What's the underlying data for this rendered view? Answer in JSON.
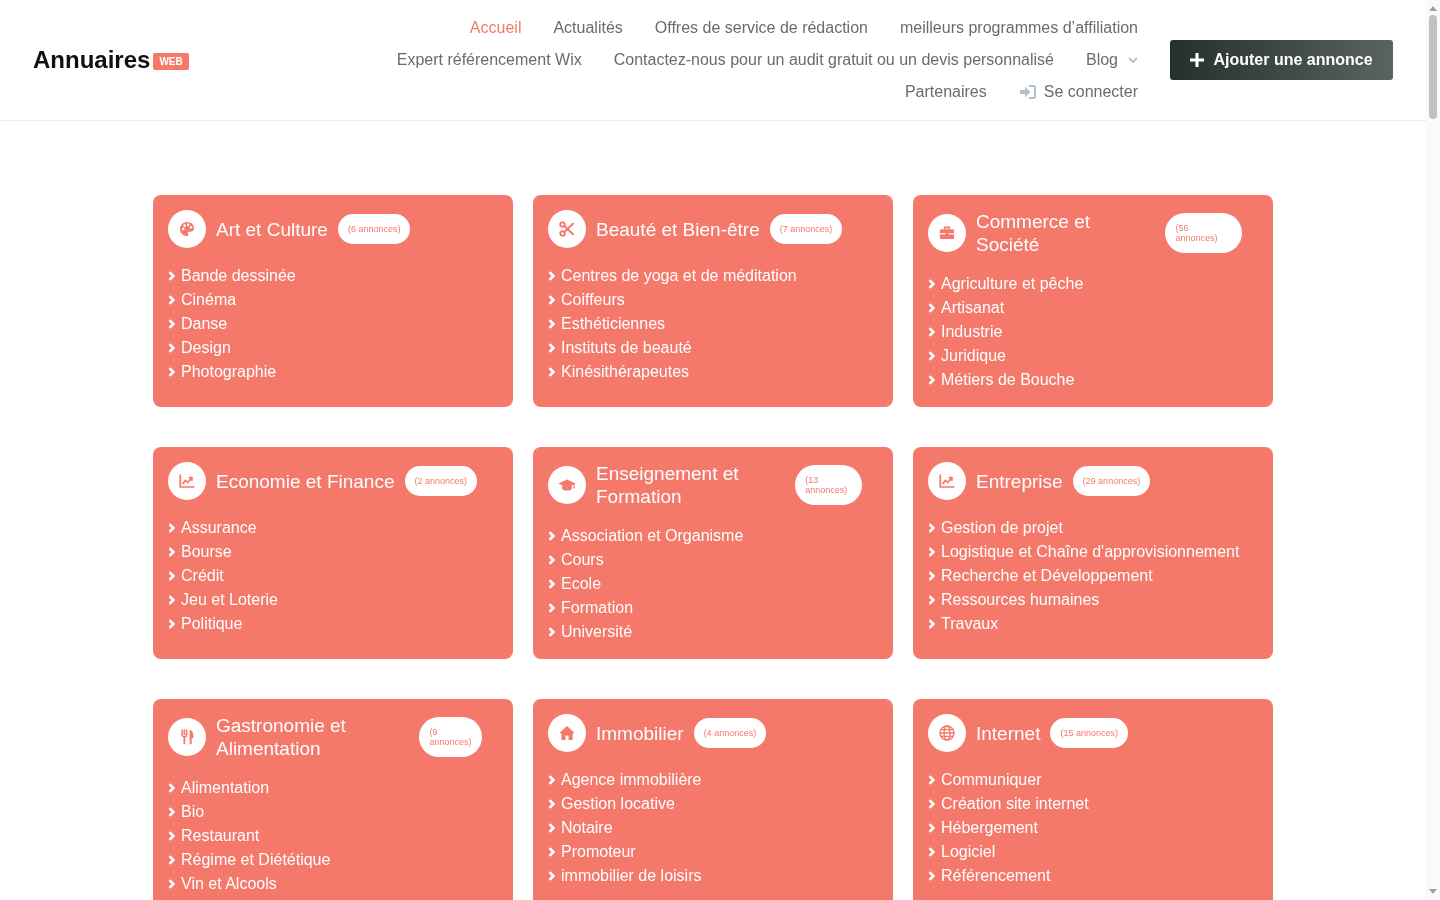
{
  "header": {
    "logo": {
      "name": "Annuaires",
      "badge": "WEB"
    },
    "nav": [
      {
        "label": "Accueil",
        "kind": "link",
        "selected": true
      },
      {
        "label": "Actualités",
        "kind": "link",
        "selected": false
      },
      {
        "label": "Offres de service de rédaction",
        "kind": "link",
        "selected": false
      },
      {
        "label": "meilleurs programmes d’affiliation",
        "kind": "link",
        "selected": false
      },
      {
        "label": "Expert référencement Wix",
        "kind": "link",
        "selected": false
      },
      {
        "label": "Contactez-nous pour un audit gratuit ou un devis personnalisé",
        "kind": "link",
        "selected": false
      },
      {
        "label": "Blog",
        "kind": "dropdown",
        "selected": false
      },
      {
        "label": "Partenaires",
        "kind": "link",
        "selected": false
      },
      {
        "label": "Se connecter",
        "kind": "login",
        "selected": false
      }
    ],
    "add_button": {
      "label": "Ajouter une annonce"
    }
  },
  "categories": [
    {
      "title": "Art et Culture",
      "count": "(6 annonces)",
      "items": [
        "Bande dessinée",
        "Cinéma",
        "Danse",
        "Design",
        "Photographie"
      ]
    },
    {
      "title": "Beauté et Bien-être",
      "count": "(7 annonces)",
      "items": [
        "Centres de yoga et de méditation",
        "Coiffeurs",
        "Esthéticiennes",
        "Instituts de beauté",
        "Kinésithérapeutes"
      ]
    },
    {
      "title": "Commerce et Société",
      "count": "(56 annonces)",
      "items": [
        "Agriculture et pêche",
        "Artisanat",
        "Industrie",
        "Juridique",
        "Métiers de Bouche"
      ]
    },
    {
      "title": "Economie et Finance",
      "count": "(2 annonces)",
      "items": [
        "Assurance",
        "Bourse",
        "Crédit",
        "Jeu et Loterie",
        "Politique"
      ]
    },
    {
      "title": "Enseignement et Formation",
      "count": "(13 annonces)",
      "items": [
        "Association et Organisme",
        "Cours",
        "Ecole",
        "Formation",
        "Université"
      ]
    },
    {
      "title": "Entreprise",
      "count": "(29 annonces)",
      "items": [
        "Gestion de projet",
        "Logistique et Chaîne d'approvisionnement",
        "Recherche et Développement",
        "Ressources humaines",
        "Travaux"
      ]
    },
    {
      "title": "Gastronomie et Alimentation",
      "count": "(9 annonces)",
      "items": [
        "Alimentation",
        "Bio",
        "Restaurant",
        "Régime et Diététique",
        "Vin et Alcools"
      ]
    },
    {
      "title": "Immobilier",
      "count": "(4 annonces)",
      "items": [
        "Agence immobilière",
        "Gestion locative",
        "Notaire",
        "Promoteur",
        "immobilier de loisirs"
      ]
    },
    {
      "title": "Internet",
      "count": "(15 annonces)",
      "items": [
        "Communiquer",
        "Création site internet",
        "Hébergement",
        "Logiciel",
        "Référencement"
      ]
    }
  ]
}
